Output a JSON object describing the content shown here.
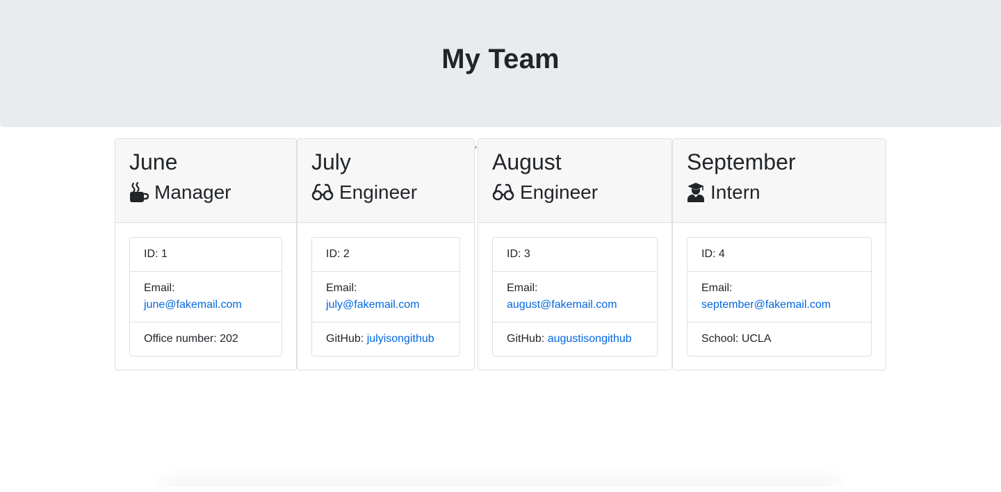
{
  "header": {
    "title": "My Team"
  },
  "cards": [
    {
      "name": "June",
      "role": "Manager",
      "icon": "mug-hot-icon",
      "id_label": "ID: 1",
      "email_label": "Email:",
      "email": "june@fakemail.com",
      "extra_label": "Office number: 202",
      "extra_link": ""
    },
    {
      "name": "July",
      "role": "Engineer",
      "icon": "glasses-icon",
      "id_label": "ID: 2",
      "email_label": "Email:",
      "email": "july@fakemail.com",
      "extra_label": "GitHub: ",
      "extra_link": "julyisongithub"
    },
    {
      "name": "August",
      "role": "Engineer",
      "icon": "glasses-icon",
      "id_label": "ID: 3",
      "email_label": "Email:",
      "email": "august@fakemail.com",
      "extra_label": "GitHub: ",
      "extra_link": "augustisongithub"
    },
    {
      "name": "September",
      "role": "Intern",
      "icon": "graduate-icon",
      "id_label": "ID: 4",
      "email_label": "Email:",
      "email": "september@fakemail.com",
      "extra_label": "School: UCLA",
      "extra_link": ""
    }
  ],
  "colors": {
    "link": "#0067e0",
    "jumbotron_bg": "#e9ecef",
    "card_header_bg": "#f7f7f7"
  }
}
